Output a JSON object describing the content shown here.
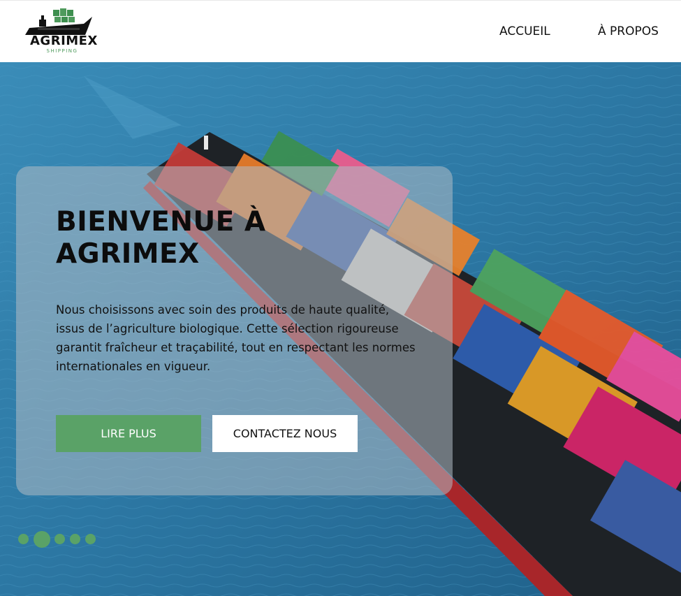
{
  "brand": {
    "name": "AGRIMEX",
    "tagline": "SHIPPING"
  },
  "nav": {
    "items": [
      {
        "label": "ACCUEIL"
      },
      {
        "label": "À PROPOS"
      }
    ]
  },
  "hero": {
    "title": "BIENVENUE À AGRIMEX",
    "description": "Nous choisissons avec soin des produits de haute qualité, issus de l’agriculture biologique. Cette sélection rigoureuse garantit fraîcheur et traçabilité, tout en respectant les normes internationales en vigueur.",
    "primary_button": "LIRE PLUS",
    "secondary_button": "CONTACTEZ NOUS",
    "background_image": "container-ship-aerial"
  },
  "carousel": {
    "slide_count": 5,
    "active_index": 1
  },
  "colors": {
    "accent": "#5aa267",
    "sea": "#2e7ea8",
    "card_overlay": "#b0bcc4"
  }
}
